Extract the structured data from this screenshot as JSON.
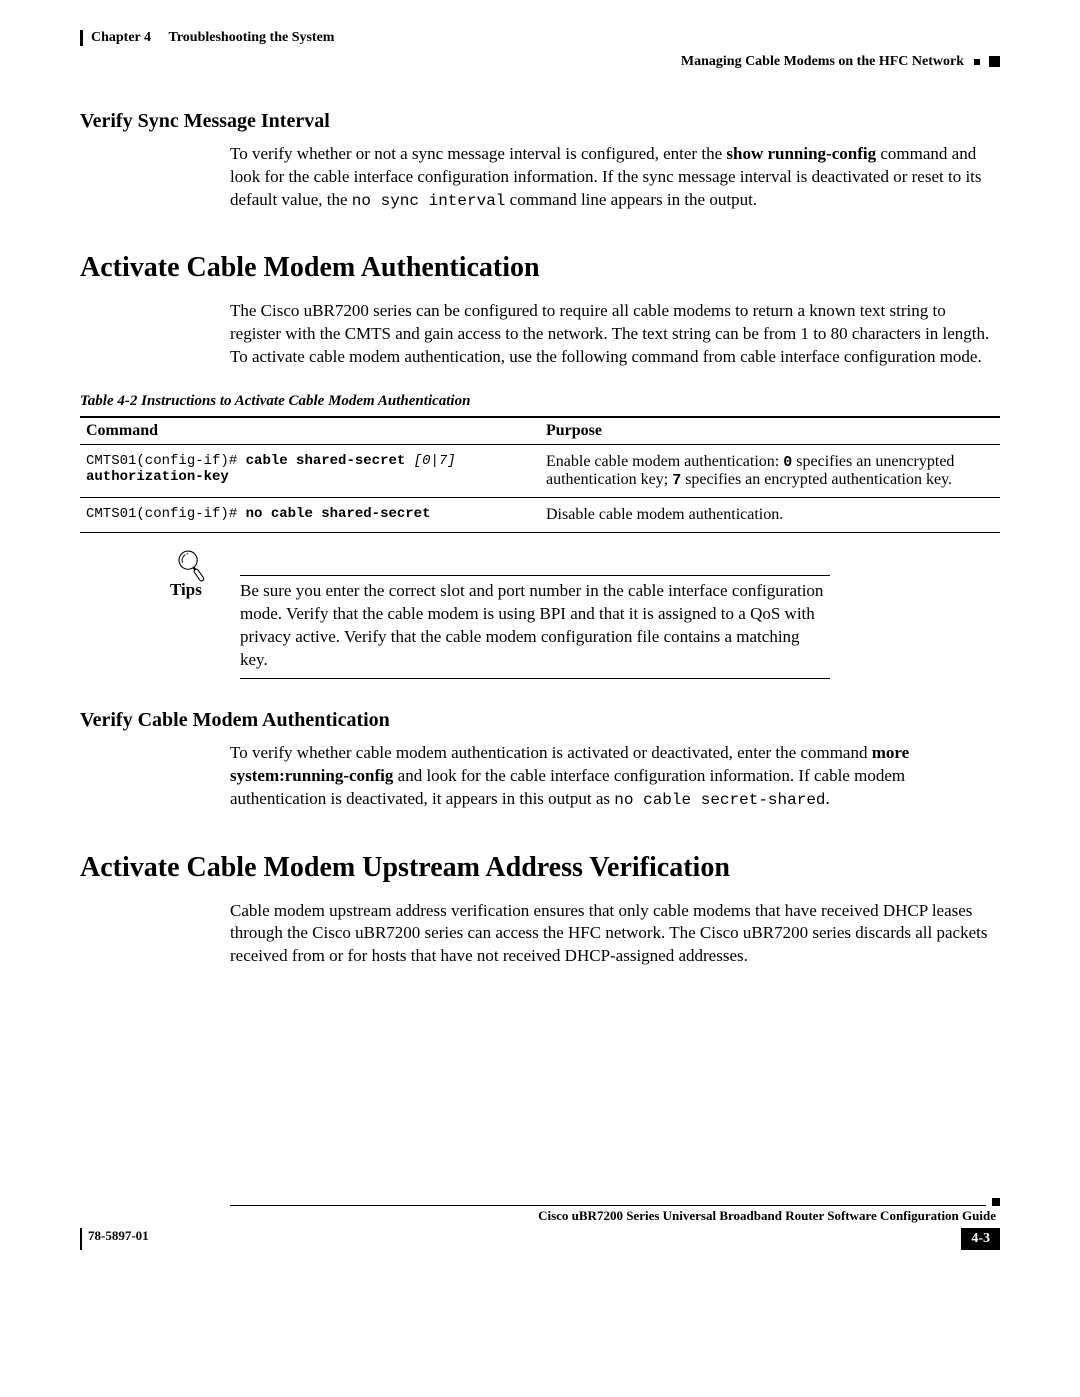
{
  "header": {
    "chapter_label": "Chapter 4",
    "chapter_title": "Troubleshooting the System",
    "section_breadcrumb": "Managing Cable Modems on the HFC Network"
  },
  "sections": {
    "verify_sync": {
      "title": "Verify Sync Message Interval",
      "para_a": "To verify whether or not a sync message interval is configured, enter the ",
      "cmd_bold": "show running-config",
      "para_b": " command and look for the cable interface configuration information. If the sync message interval is deactivated or reset to its default value, the ",
      "mono": "no sync interval",
      "para_c": " command line appears in the output."
    },
    "activate_auth": {
      "title": "Activate Cable Modem Authentication",
      "para": "The Cisco uBR7200 series can be configured to require all cable modems to return a known text string to register with the CMTS and gain access to the network. The text string can be from 1 to 80 characters in length. To activate cable modem authentication, use the following command from cable interface configuration mode.",
      "table_caption": "Table 4-2      Instructions to Activate Cable Modem Authentication",
      "table": {
        "headers": {
          "cmd": "Command",
          "purpose": "Purpose"
        },
        "rows": [
          {
            "prompt": "CMTS01(config-if)# ",
            "cmd_bold": "cable shared-secret ",
            "cmd_ital": "[0|7] ",
            "cmd_bold2": "authorization-key",
            "purpose_a": "Enable cable modem authentication: ",
            "purpose_zero": "0",
            "purpose_b": " specifies an unencrypted authentication key; ",
            "purpose_seven": "7",
            "purpose_c": " specifies an encrypted authentication key."
          },
          {
            "prompt": "CMTS01(config-if)# ",
            "cmd_bold": "no cable shared-secret",
            "purpose": "Disable cable modem authentication."
          }
        ]
      },
      "tips_label": "Tips",
      "tips_text": "Be sure you enter the correct slot and port number in the cable interface configuration mode. Verify that the cable modem is using BPI and that it is assigned to a QoS with privacy active. Verify that the cable modem configuration file contains a matching key."
    },
    "verify_auth": {
      "title": "Verify Cable Modem Authentication",
      "para_a": "To verify whether cable modem authentication is activated or deactivated, enter the command ",
      "cmd_bold": "more system:running-config",
      "para_b": " and look for the cable interface configuration information. If cable modem authentication is deactivated, it appears in this output as ",
      "mono": "no cable secret-shared",
      "para_c": "."
    },
    "activate_upstream": {
      "title": "Activate Cable Modem Upstream Address Verification",
      "para": "Cable modem upstream address verification ensures that only cable modems that have received DHCP leases through the Cisco uBR7200 series can access the HFC network. The Cisco uBR7200 series discards all packets received from or for hosts that have not received DHCP-assigned addresses."
    }
  },
  "footer": {
    "guide_title": "Cisco uBR7200 Series Universal Broadband Router Software Configuration Guide",
    "doc_number": "78-5897-01",
    "page_number": "4-3"
  }
}
